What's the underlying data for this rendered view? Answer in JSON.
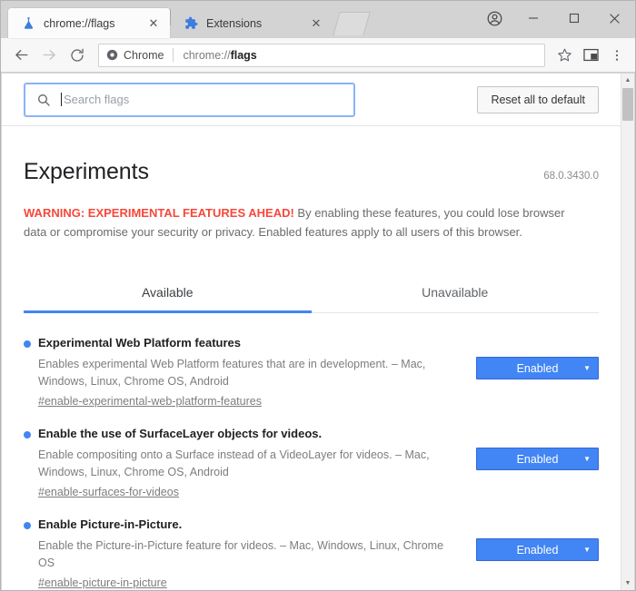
{
  "window": {
    "controls": {
      "profile": "profile-avatar",
      "minimize": "–",
      "maximize": "□",
      "close": "✕"
    }
  },
  "tabstrip": {
    "tabs": [
      {
        "title": "chrome://flags",
        "favicon": "flask-icon",
        "active": true,
        "close": "✕"
      },
      {
        "title": "Extensions",
        "favicon": "puzzle-icon",
        "active": false,
        "close": "✕"
      }
    ],
    "new_tab_label": "+"
  },
  "toolbar": {
    "back": "←",
    "forward": "→",
    "reload": "⟳",
    "omnibox": {
      "chip_label": "Chrome",
      "url_prefix": "chrome://",
      "url_bold": "flags"
    },
    "bookmark": "star-icon",
    "pip": "picture-in-picture-icon",
    "menu": "⋮"
  },
  "flags_page": {
    "search": {
      "placeholder": "Search flags",
      "value": ""
    },
    "reset_button": "Reset all to default",
    "title": "Experiments",
    "version": "68.0.3430.0",
    "warning": {
      "strong": "WARNING: EXPERIMENTAL FEATURES AHEAD!",
      "rest": " By enabling these features, you could lose browser data or compromise your security or privacy. Enabled features apply to all users of this browser."
    },
    "tabs": [
      {
        "label": "Available",
        "selected": true
      },
      {
        "label": "Unavailable",
        "selected": false
      }
    ],
    "flags": [
      {
        "title": "Experimental Web Platform features",
        "description": "Enables experimental Web Platform features that are in development. – Mac, Windows, Linux, Chrome OS, Android",
        "permalink": "#enable-experimental-web-platform-features",
        "state": "Enabled"
      },
      {
        "title": "Enable the use of SurfaceLayer objects for videos.",
        "description": "Enable compositing onto a Surface instead of a VideoLayer for videos. – Mac, Windows, Linux, Chrome OS, Android",
        "permalink": "#enable-surfaces-for-videos",
        "state": "Enabled"
      },
      {
        "title": "Enable Picture-in-Picture.",
        "description": "Enable the Picture-in-Picture feature for videos. – Mac, Windows, Linux, Chrome OS",
        "permalink": "#enable-picture-in-picture",
        "state": "Enabled"
      }
    ],
    "select_arrow": "▼"
  },
  "scrollbar": {
    "up": "▲",
    "down": "▼"
  },
  "colors": {
    "accent_blue": "#4285f4",
    "warning_red": "#f5483b",
    "tab_indicator": "#4285f4"
  }
}
